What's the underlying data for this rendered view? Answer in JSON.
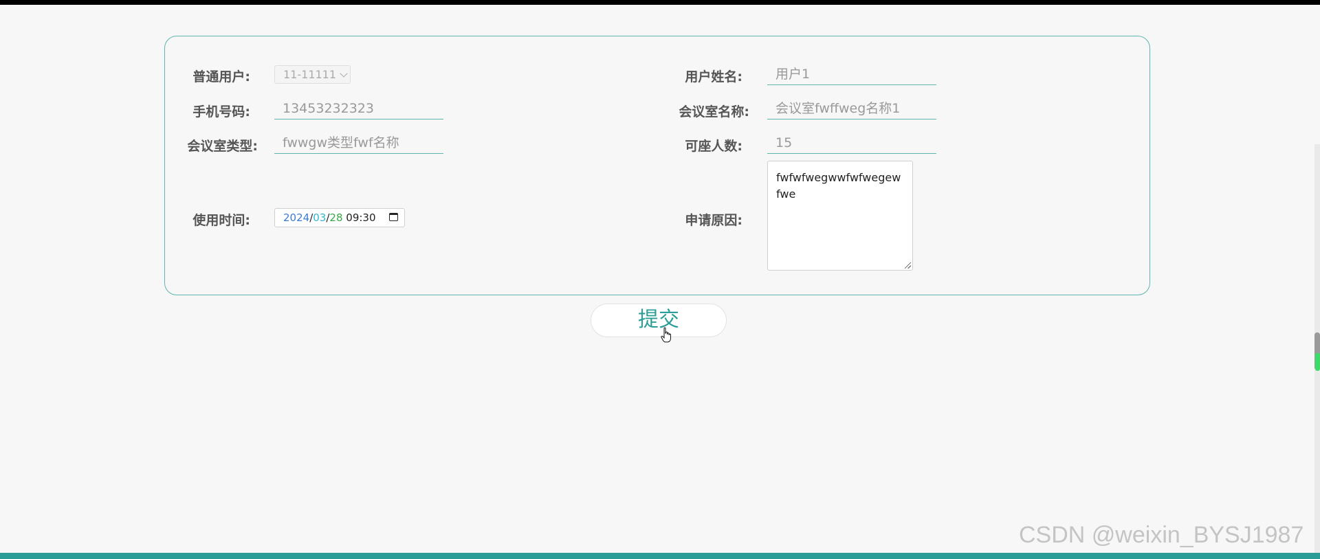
{
  "form": {
    "user_label": "普通用户:",
    "user_select_value": "11-11111",
    "name_label": "用户姓名:",
    "name_value": "用户1",
    "phone_label": "手机号码:",
    "phone_value": "13453232323",
    "room_name_label": "会议室名称:",
    "room_name_value": "会议室fwffweg名称1",
    "room_type_label": "会议室类型:",
    "room_type_value": "fwwgw类型fwf名称",
    "capacity_label": "可座人数:",
    "capacity_value": "15",
    "time_label": "使用时间:",
    "time_year": "2024",
    "time_month": "03",
    "time_day": "28",
    "time_clock": "09:30",
    "reason_label": "申请原因:",
    "reason_value": "fwfwfwegwwfwfwegewfwe"
  },
  "submit_label": "提交",
  "watermark": "CSDN @weixin_BYSJ1987",
  "colors": {
    "accent": "#2a9d96",
    "border": "#5db5ae",
    "background": "#f7f7f7"
  },
  "icons": {
    "select": "chevron-down-icon",
    "datetime": "calendar-icon",
    "cursor": "hand-pointer-icon"
  }
}
